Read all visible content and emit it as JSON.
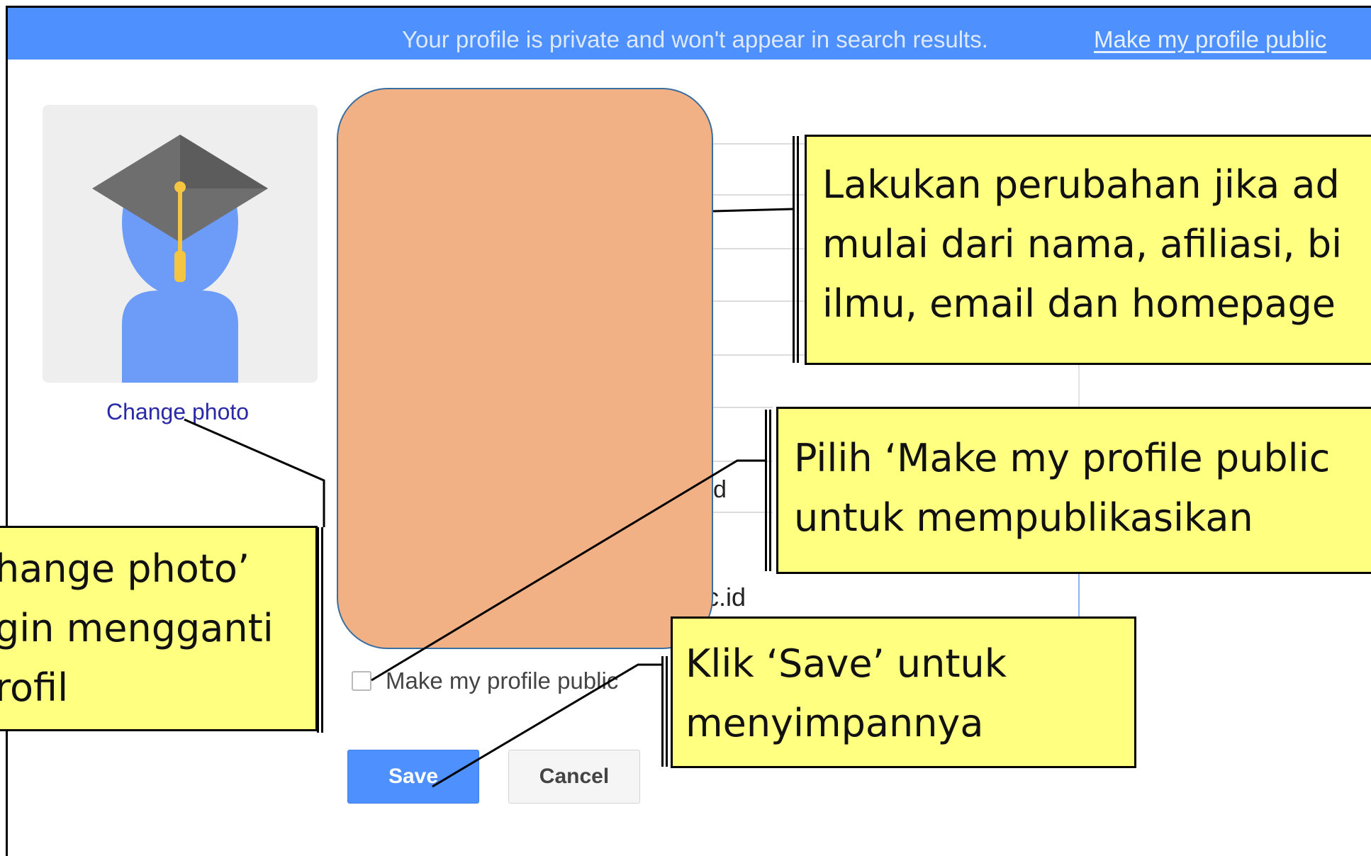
{
  "banner": {
    "message": "Your profile is private and won't appear in search results.",
    "link": "Make my profile public"
  },
  "photo": {
    "change_label": "Change photo"
  },
  "form": {
    "fragment_d": "d",
    "fragment_email": "c.id",
    "public_checkbox_label": "Make my profile public",
    "save_label": "Save",
    "cancel_label": "Cancel"
  },
  "callouts": {
    "edit": "Lakukan perubahan jika ad\nmulai dari nama, afiliasi, bi\nilmu, email dan homepage",
    "public": "Pilih ‘Make my profile public\nuntuk mempublikasikan",
    "save": "Klik ‘Save’ untuk\nmenyimpannya",
    "photo": "hange photo’\ngin mengganti\nrofil"
  },
  "colors": {
    "banner": "#4d90fe",
    "callout": "#ffff80",
    "redaction": "#f2b185",
    "avatar": "#6c9cf7",
    "cap": "#666666",
    "tassel": "#f5c542"
  },
  "icons": {
    "avatar": "graduate-avatar-icon",
    "checkbox": "checkbox-icon"
  }
}
